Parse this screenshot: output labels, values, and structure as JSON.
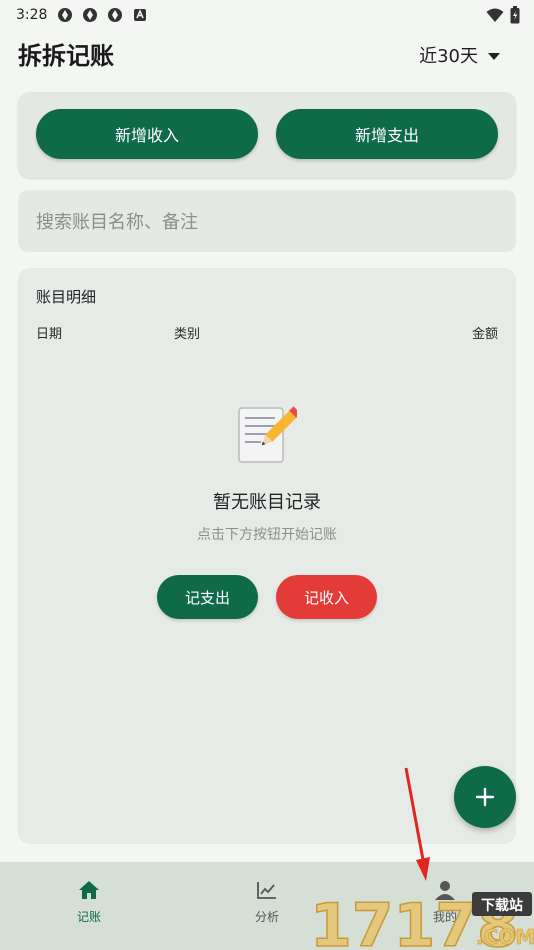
{
  "status_bar": {
    "time": "3:28"
  },
  "header": {
    "title": "拆拆记账",
    "period": "近30天"
  },
  "actions": {
    "add_income": "新增收入",
    "add_expense": "新增支出"
  },
  "search": {
    "placeholder": "搜索账目名称、备注"
  },
  "ledger": {
    "title": "账目明细",
    "columns": [
      "日期",
      "类别",
      "金额"
    ],
    "empty_title": "暂无账目记录",
    "empty_subtitle": "点击下方按钮开始记账",
    "record_expense": "记支出",
    "record_income": "记收入"
  },
  "nav": {
    "items": [
      {
        "label": "记账",
        "icon": "home-icon",
        "active": true
      },
      {
        "label": "分析",
        "icon": "chart-icon",
        "active": false
      },
      {
        "label": "我的",
        "icon": "person-icon",
        "active": false
      }
    ]
  },
  "watermark": {
    "text": "17178",
    "badge": "下载站",
    "domain": ".COM"
  },
  "colors": {
    "primary": "#0e6a49",
    "danger": "#e23b38",
    "background": "#f4f6f3"
  }
}
